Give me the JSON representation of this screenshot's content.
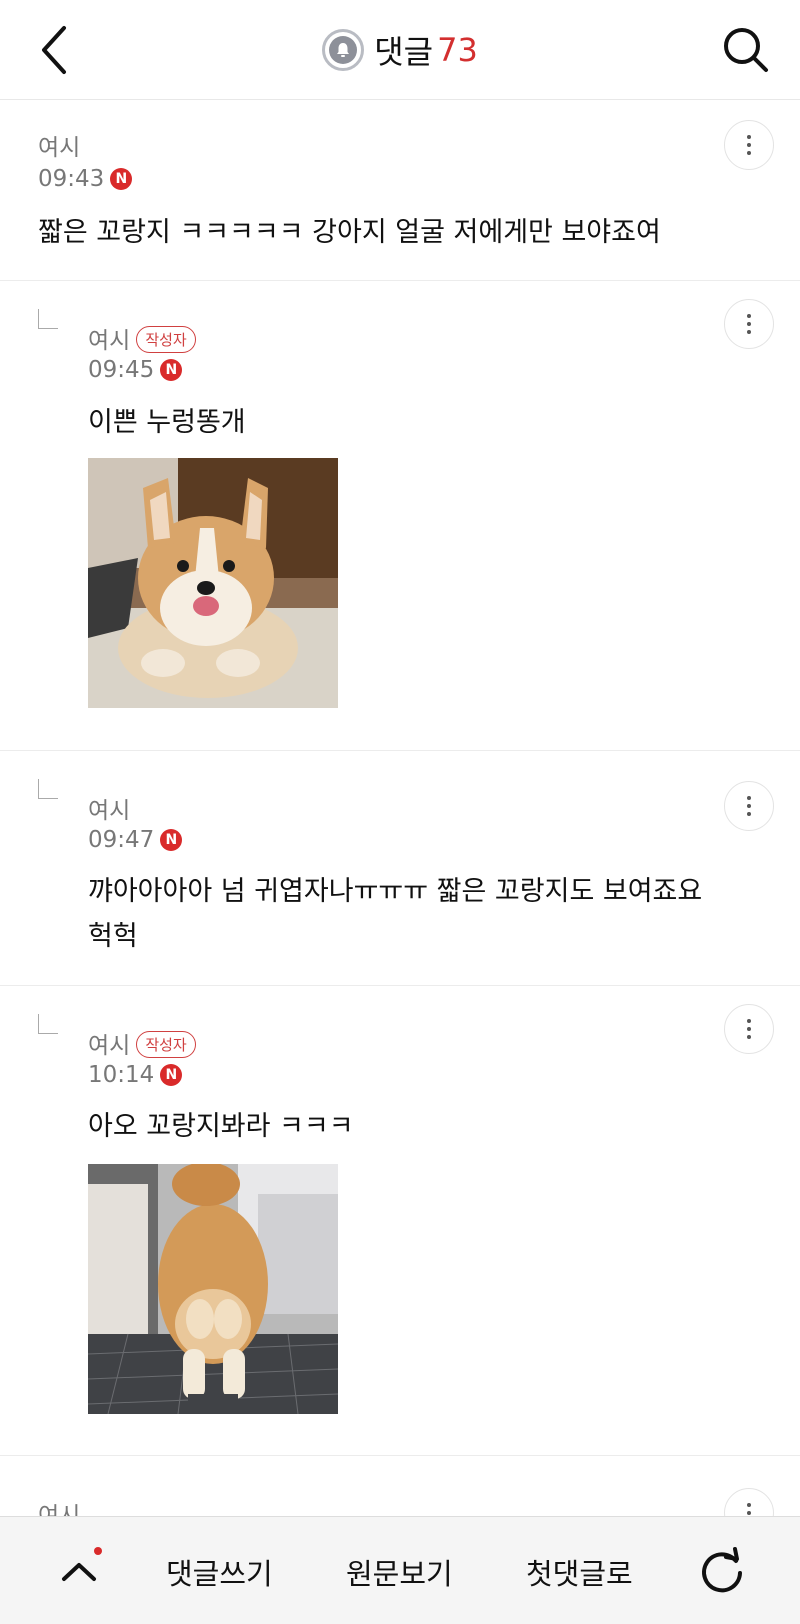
{
  "header": {
    "title": "댓글",
    "count": "73",
    "back_icon": "chevron-left-icon",
    "search_icon": "search-icon",
    "bell_icon": "bell-icon"
  },
  "comments": [
    {
      "author": "여시",
      "time": "09:43",
      "new_badge": "N",
      "text": "짧은 꼬랑지 ㅋㅋㅋㅋㅋ 강아지 얼굴 저에게만 보야죠여"
    },
    {
      "author": "여시",
      "author_tag": "작성자",
      "time": "09:45",
      "new_badge": "N",
      "text": "이쁜 누렁똥개",
      "image": "corgi-face-photo"
    },
    {
      "author": "여시",
      "time": "09:47",
      "new_badge": "N",
      "text_line1": "꺄아아아아 넘 귀엽자나ㅠㅠㅠ 짧은 꼬랑지도 보여죠요",
      "text_line2": "헉헉"
    },
    {
      "author": "여시",
      "author_tag": "작성자",
      "time": "10:14",
      "new_badge": "N",
      "text": "아오 꼬랑지봐라 ㅋㅋㅋ",
      "image": "corgi-back-photo"
    },
    {
      "author": "여시"
    }
  ],
  "bottom_bar": {
    "write_comment": "댓글쓰기",
    "view_original": "원문보기",
    "first_comment": "첫댓글로",
    "up_icon": "chevron-up-icon",
    "refresh_icon": "refresh-icon"
  },
  "colors": {
    "accent_red": "#d32f2f",
    "meta_gray": "#777777"
  }
}
